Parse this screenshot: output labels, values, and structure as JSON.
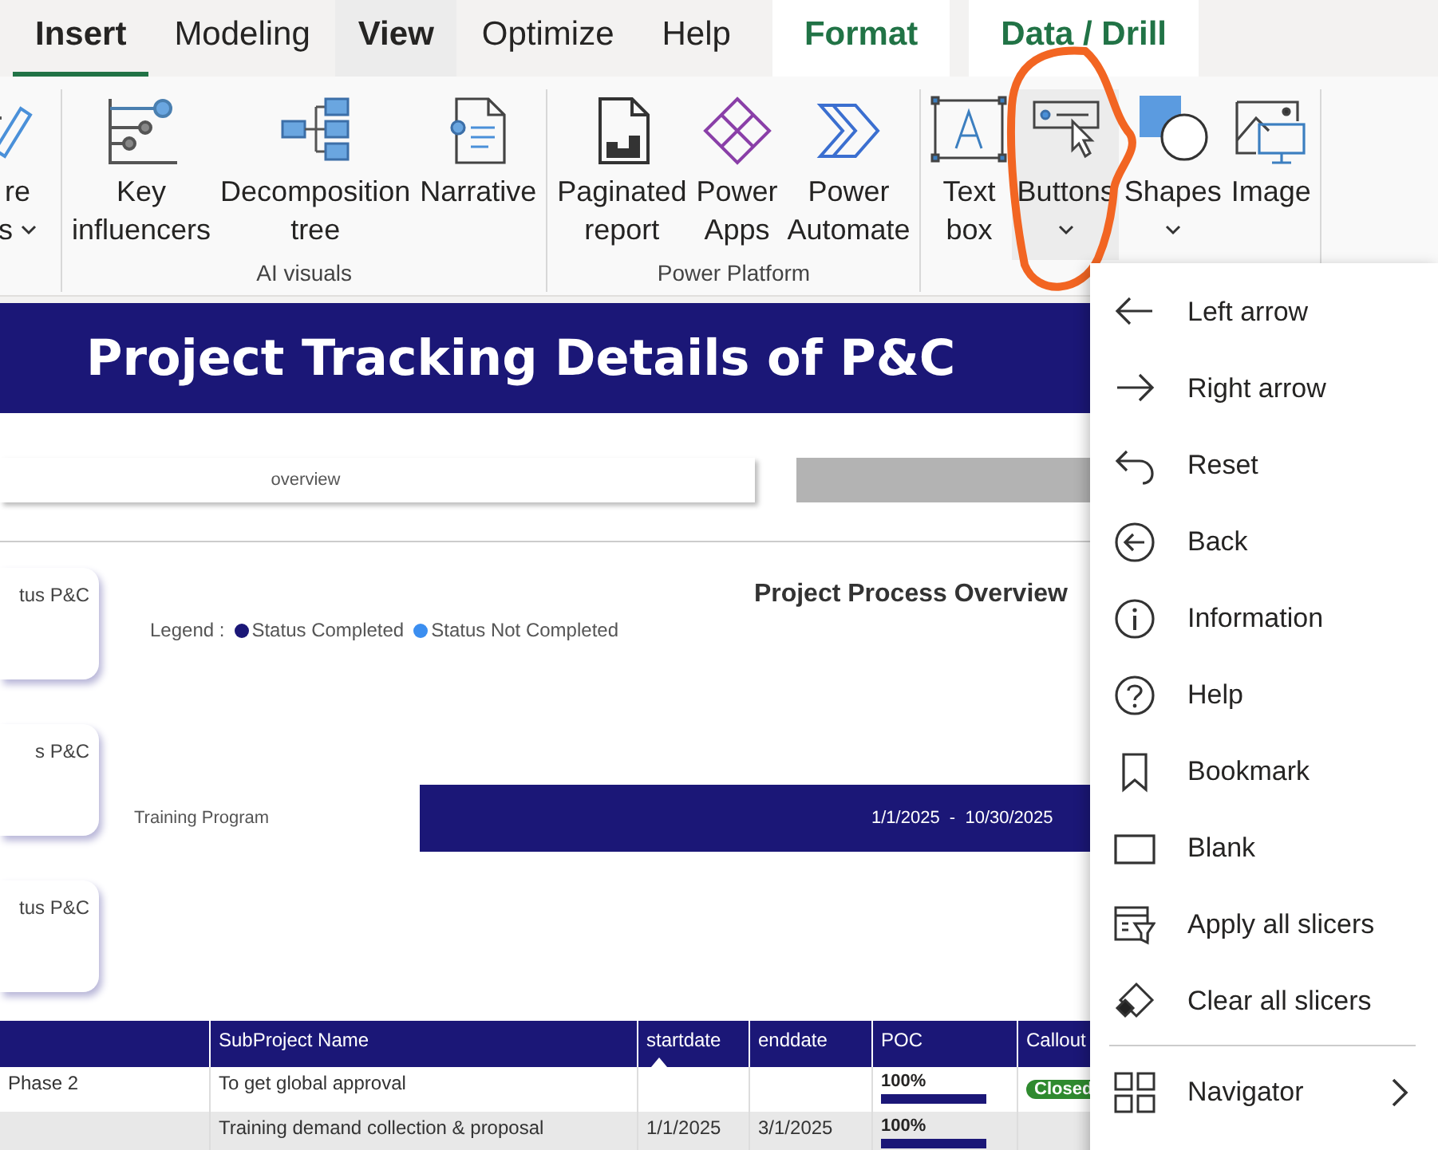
{
  "tabs": [
    {
      "label": "Insert",
      "selected": true,
      "kind": "normal"
    },
    {
      "label": "Modeling",
      "selected": false,
      "kind": "normal"
    },
    {
      "label": "View",
      "selected": false,
      "kind": "hover"
    },
    {
      "label": "Optimize",
      "selected": false,
      "kind": "normal"
    },
    {
      "label": "Help",
      "selected": false,
      "kind": "normal"
    },
    {
      "label": "Format",
      "selected": false,
      "kind": "contextual"
    },
    {
      "label": "Data / Drill",
      "selected": false,
      "kind": "contextual"
    }
  ],
  "ribbon": {
    "groups": [
      {
        "items": [
          {
            "lines": [
              "re",
              "s"
            ],
            "dropdown": true,
            "circled": false
          }
        ]
      },
      {
        "label": "AI visuals",
        "items": [
          {
            "lines": [
              "Key",
              "influencers"
            ],
            "dropdown": false,
            "circled": false
          },
          {
            "lines": [
              "Decomposition",
              "tree"
            ],
            "dropdown": false,
            "circled": false
          },
          {
            "lines": [
              "Narrative"
            ],
            "dropdown": false,
            "circled": false
          }
        ]
      },
      {
        "label": "Power Platform",
        "items": [
          {
            "lines": [
              "Paginated",
              "report"
            ],
            "dropdown": false,
            "circled": false
          },
          {
            "lines": [
              "Power",
              "Apps"
            ],
            "dropdown": false,
            "circled": false
          },
          {
            "lines": [
              "Power",
              "Automate"
            ],
            "dropdown": false,
            "circled": false
          }
        ]
      },
      {
        "items": [
          {
            "lines": [
              "Text",
              "box"
            ],
            "dropdown": false,
            "circled": false
          },
          {
            "lines": [
              "Buttons"
            ],
            "dropdown": true,
            "circled": true
          },
          {
            "lines": [
              "Shapes"
            ],
            "dropdown": true,
            "circled": false
          },
          {
            "lines": [
              "Image"
            ],
            "dropdown": false,
            "circled": false
          }
        ]
      }
    ]
  },
  "report": {
    "title": "Project Tracking Details of P&C",
    "nav_buttons": [
      {
        "label": "overview",
        "selected": false
      },
      {
        "selected": true
      }
    ],
    "cards": [
      "tus P&C",
      "s P&C",
      "tus P&C"
    ],
    "chart_title": "Project Process Overview",
    "legend": {
      "label": "Legend :",
      "entries": [
        {
          "label": "Status Completed",
          "color": "#1b1777"
        },
        {
          "label": "Status Not Completed",
          "color": "#3b8ef0"
        }
      ]
    },
    "gantt": [
      {
        "label": "Training Program",
        "dates": "1/1/2025  -  10/30/2025",
        "completed": true
      }
    ],
    "table": {
      "columns": [
        {
          "sorted": false
        },
        {
          "label": "SubProject Name",
          "sorted": false
        },
        {
          "label": "startdate",
          "sorted": true
        },
        {
          "label": "enddate",
          "sorted": false
        },
        {
          "label": "POC",
          "sorted": false
        },
        {
          "label": "Callout",
          "sorted": false
        }
      ],
      "rows": [
        {
          "phase": "Phase 2",
          "name": "To get global approval",
          "start": null,
          "end": null,
          "poc": "100%",
          "level": 1,
          "callout": "Closed"
        },
        {
          "phase": null,
          "name": "Training demand collection & proposal",
          "start": "1/1/2025",
          "end": "3/1/2025",
          "poc": "100%",
          "level": 1,
          "callout": null
        }
      ]
    }
  },
  "menu": {
    "items": [
      {
        "label": "Left arrow",
        "submenu": false
      },
      {
        "label": "Right arrow",
        "submenu": false
      },
      {
        "label": "Reset",
        "submenu": false
      },
      {
        "label": "Back",
        "submenu": false
      },
      {
        "label": "Information",
        "submenu": false
      },
      {
        "label": "Help",
        "submenu": false
      },
      {
        "label": "Bookmark",
        "submenu": false
      },
      {
        "label": "Blank",
        "submenu": false
      },
      {
        "label": "Apply all slicers",
        "submenu": false
      },
      {
        "label": "Clear all slicers",
        "submenu": false
      },
      {
        "label": "Navigator",
        "submenu": true
      }
    ]
  }
}
